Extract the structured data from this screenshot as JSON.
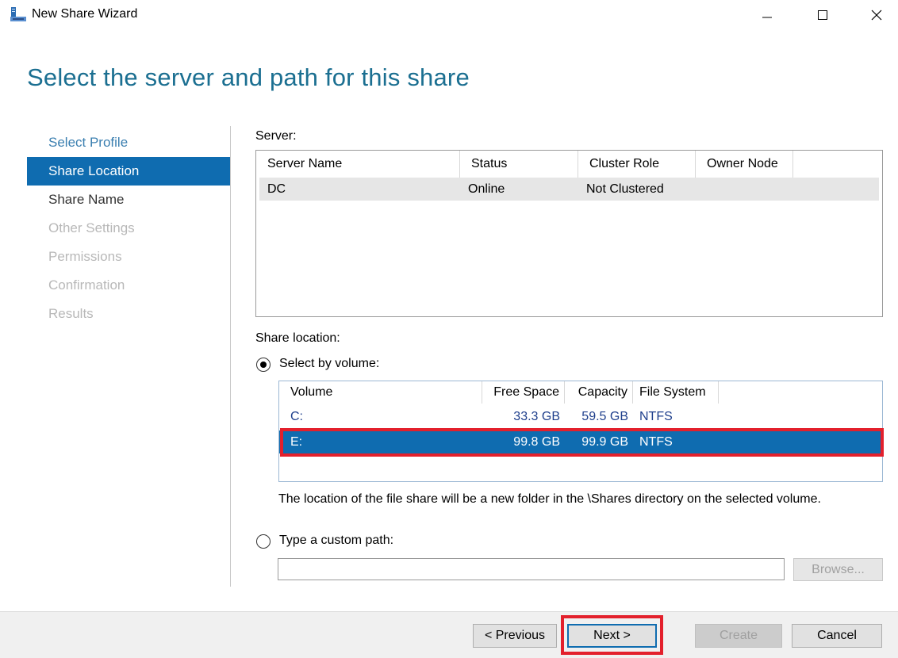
{
  "window": {
    "title": "New Share Wizard",
    "icon": "server-share-icon",
    "controls": {
      "minimize": "minimize-icon",
      "maximize": "maximize-icon",
      "close": "close-icon"
    }
  },
  "page_title": "Select the server and path for this share",
  "nav": {
    "items": [
      {
        "label": "Select Profile",
        "state": "done"
      },
      {
        "label": "Share Location",
        "state": "active"
      },
      {
        "label": "Share Name",
        "state": "pending"
      },
      {
        "label": "Other Settings",
        "state": "disabled"
      },
      {
        "label": "Permissions",
        "state": "disabled"
      },
      {
        "label": "Confirmation",
        "state": "disabled"
      },
      {
        "label": "Results",
        "state": "disabled"
      }
    ]
  },
  "server": {
    "label": "Server:",
    "columns": [
      "Server Name",
      "Status",
      "Cluster Role",
      "Owner Node"
    ],
    "rows": [
      {
        "name": "DC",
        "status": "Online",
        "cluster_role": "Not Clustered",
        "owner_node": ""
      }
    ]
  },
  "share_location": {
    "label": "Share location:",
    "select_by_volume": {
      "label": "Select by volume:",
      "checked": true
    },
    "volume_columns": [
      "Volume",
      "Free Space",
      "Capacity",
      "File System"
    ],
    "volumes": [
      {
        "volume": "C:",
        "free_space": "33.3 GB",
        "capacity": "59.5 GB",
        "file_system": "NTFS",
        "selected": false
      },
      {
        "volume": "E:",
        "free_space": "99.8 GB",
        "capacity": "99.9 GB",
        "file_system": "NTFS",
        "selected": true
      }
    ],
    "note": "The location of the file share will be a new folder in the \\Shares directory on the selected volume.",
    "custom_path": {
      "label": "Type a custom path:",
      "checked": false,
      "value": ""
    },
    "browse_label": "Browse..."
  },
  "buttons": {
    "previous": "< Previous",
    "next": "Next >",
    "create": "Create",
    "cancel": "Cancel"
  },
  "colors": {
    "accent": "#0f6cb0",
    "title": "#1b6f91",
    "highlight": "#e3202c"
  }
}
